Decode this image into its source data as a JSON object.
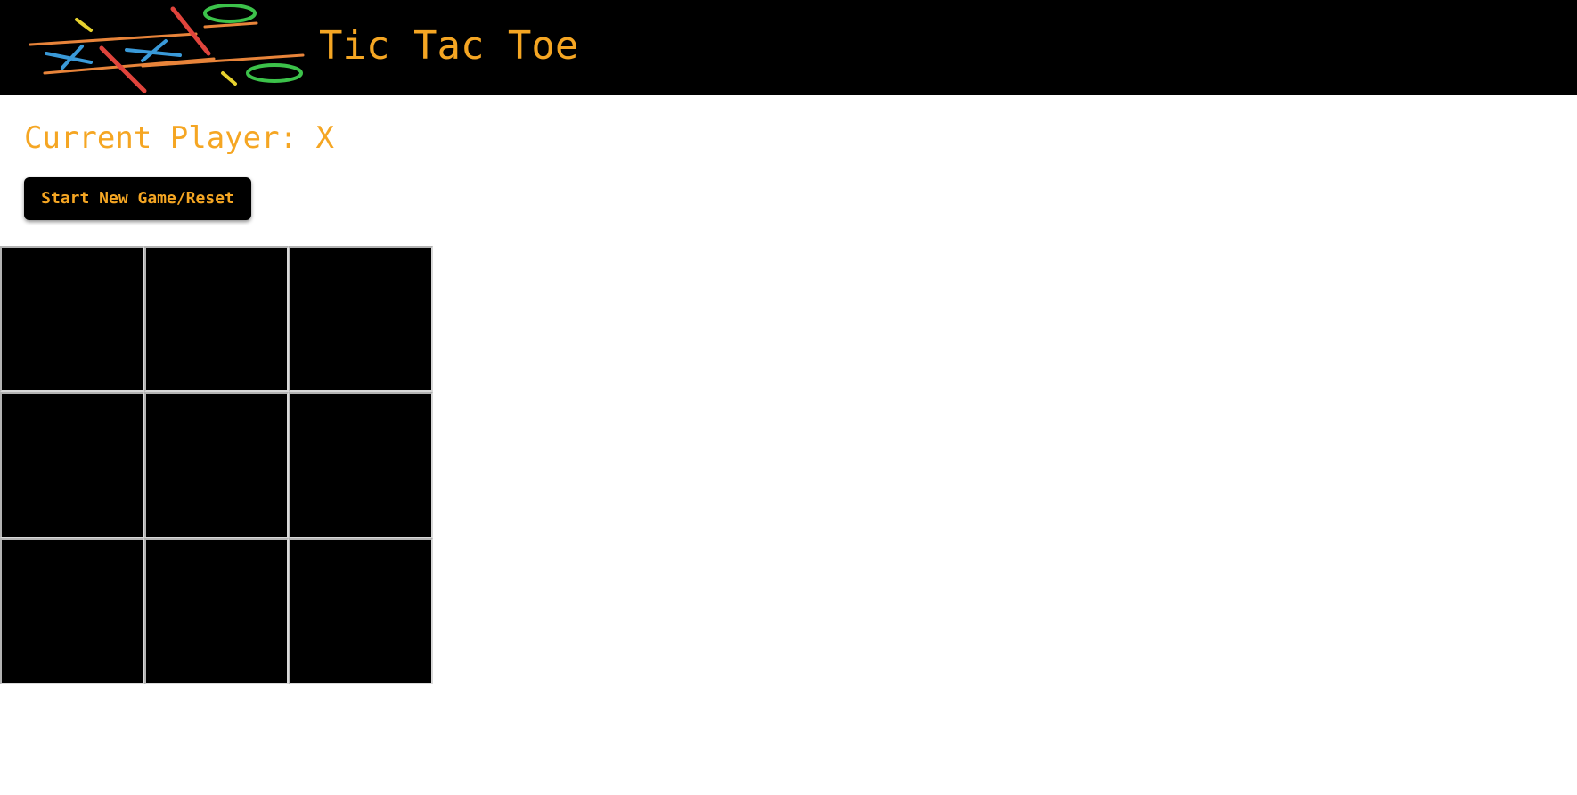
{
  "header": {
    "title": "Tic Tac Toe",
    "logo_icon": "tic-tac-toe-logo-icon"
  },
  "status": {
    "current_player_text": "Current Player: X"
  },
  "controls": {
    "reset_label": "Start New Game/Reset"
  },
  "board": {
    "cells": [
      "",
      "",
      "",
      "",
      "",
      "",
      "",
      "",
      ""
    ]
  },
  "colors": {
    "accent": "#f5a623",
    "header_bg": "#000000",
    "cell_bg": "#000000",
    "page_bg": "#ffffff",
    "logo_red": "#e0443c",
    "logo_blue": "#3a9ad9",
    "logo_green": "#3cc24a",
    "logo_yellow": "#e6d12e",
    "logo_orange": "#e8843a"
  }
}
